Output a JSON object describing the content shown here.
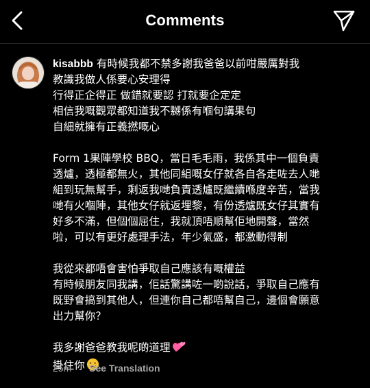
{
  "header": {
    "title": "Comments"
  },
  "comment": {
    "username": "kisabbb",
    "lines_p1": [
      "有時候我都不禁多謝我爸爸以前咁嚴厲對我",
      "教識我做人係要心安理得",
      "行得正企得正 做錯就要認 打就要企定定",
      "相信我嘅觀眾都知道我不嬲係有嗰句講果句",
      "自細就擁有正義撚嘅心"
    ],
    "lines_p2": [
      "Form 1果陣學校 BBQ，當日毛毛雨，我係其中一個負責",
      "透爐，透極都無火，其他同組嘅女仔就各自各走咗去人哋",
      "組到玩無幫手，剩返我哋負責透爐既繼續喺度辛苦，當我",
      "哋有火嗰陣，其他女仔就返埋黎，有份透爐既女仔其實有",
      "好多不滿，但個個屈住，我就頂唔順幫佢地開聲，當然",
      "啦，可以有更好處理手法，年少氣盛，都激動得制"
    ],
    "lines_p3": [
      "我從來都唔會害怕爭取自己應該有嘅權益",
      "有時候朋友同我講，佢話驚講咗一啲說話，爭取自己應有",
      "既野會搞到其他人，但連你自己都唔幫自己，邊個會願意",
      "出力幫你？"
    ],
    "line_p4_1": "我多謝爸爸教我呢啲道理",
    "line_p4_2": "掛住你",
    "emoji_1": "two-hearts-icon",
    "emoji_2": "crying-face-icon",
    "time": "25m",
    "translation_label": "See Translation"
  }
}
